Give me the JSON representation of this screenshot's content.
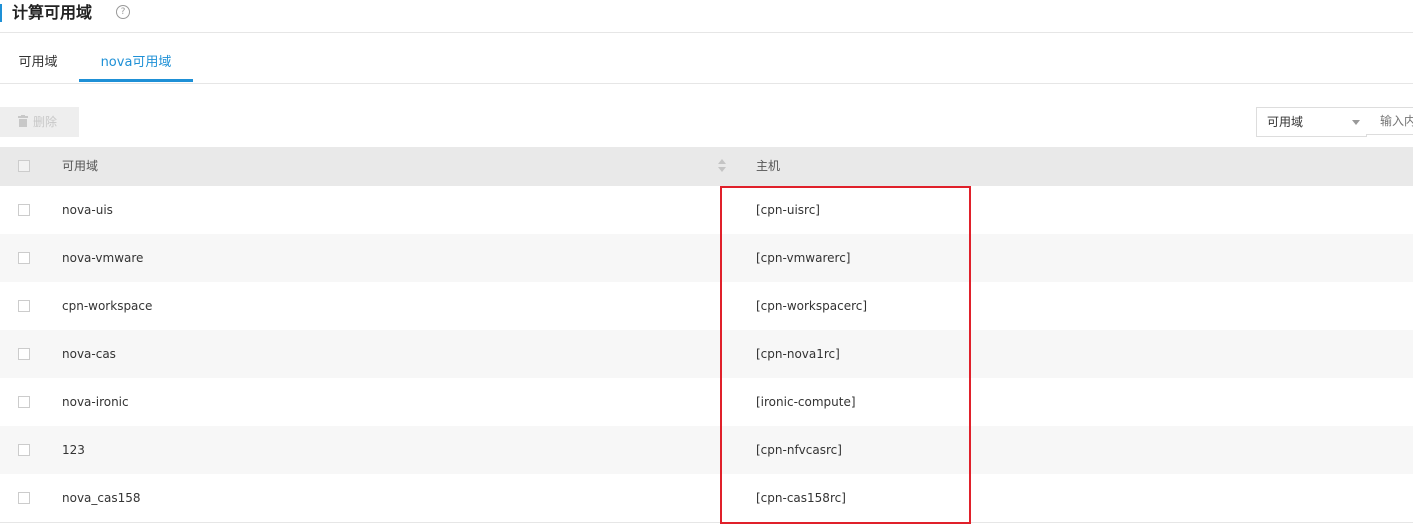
{
  "header": {
    "title": "计算可用域",
    "help": "?"
  },
  "tabs": [
    {
      "label": "可用域",
      "active": false
    },
    {
      "label": "nova可用域",
      "active": true
    }
  ],
  "toolbar": {
    "delete_label": "删除",
    "delete_icon": "trash-icon",
    "delete_disabled": true
  },
  "filter": {
    "field_value": "可用域",
    "input_placeholder": "输入内容"
  },
  "table": {
    "columns": [
      "可用域",
      "主机"
    ],
    "rows": [
      {
        "zone": "nova-uis",
        "host": "[cpn-uisrc]"
      },
      {
        "zone": "nova-vmware",
        "host": "[cpn-vmwarerc]"
      },
      {
        "zone": "cpn-workspace",
        "host": "[cpn-workspacerc]"
      },
      {
        "zone": "nova-cas",
        "host": "[cpn-nova1rc]"
      },
      {
        "zone": "nova-ironic",
        "host": "[ironic-compute]"
      },
      {
        "zone": "123",
        "host": "[cpn-nfvcasrc]"
      },
      {
        "zone": "nova_cas158",
        "host": "[cpn-cas158rc]"
      }
    ]
  },
  "colors": {
    "accent": "#1e90d6",
    "highlight_box": "#e0202a"
  }
}
